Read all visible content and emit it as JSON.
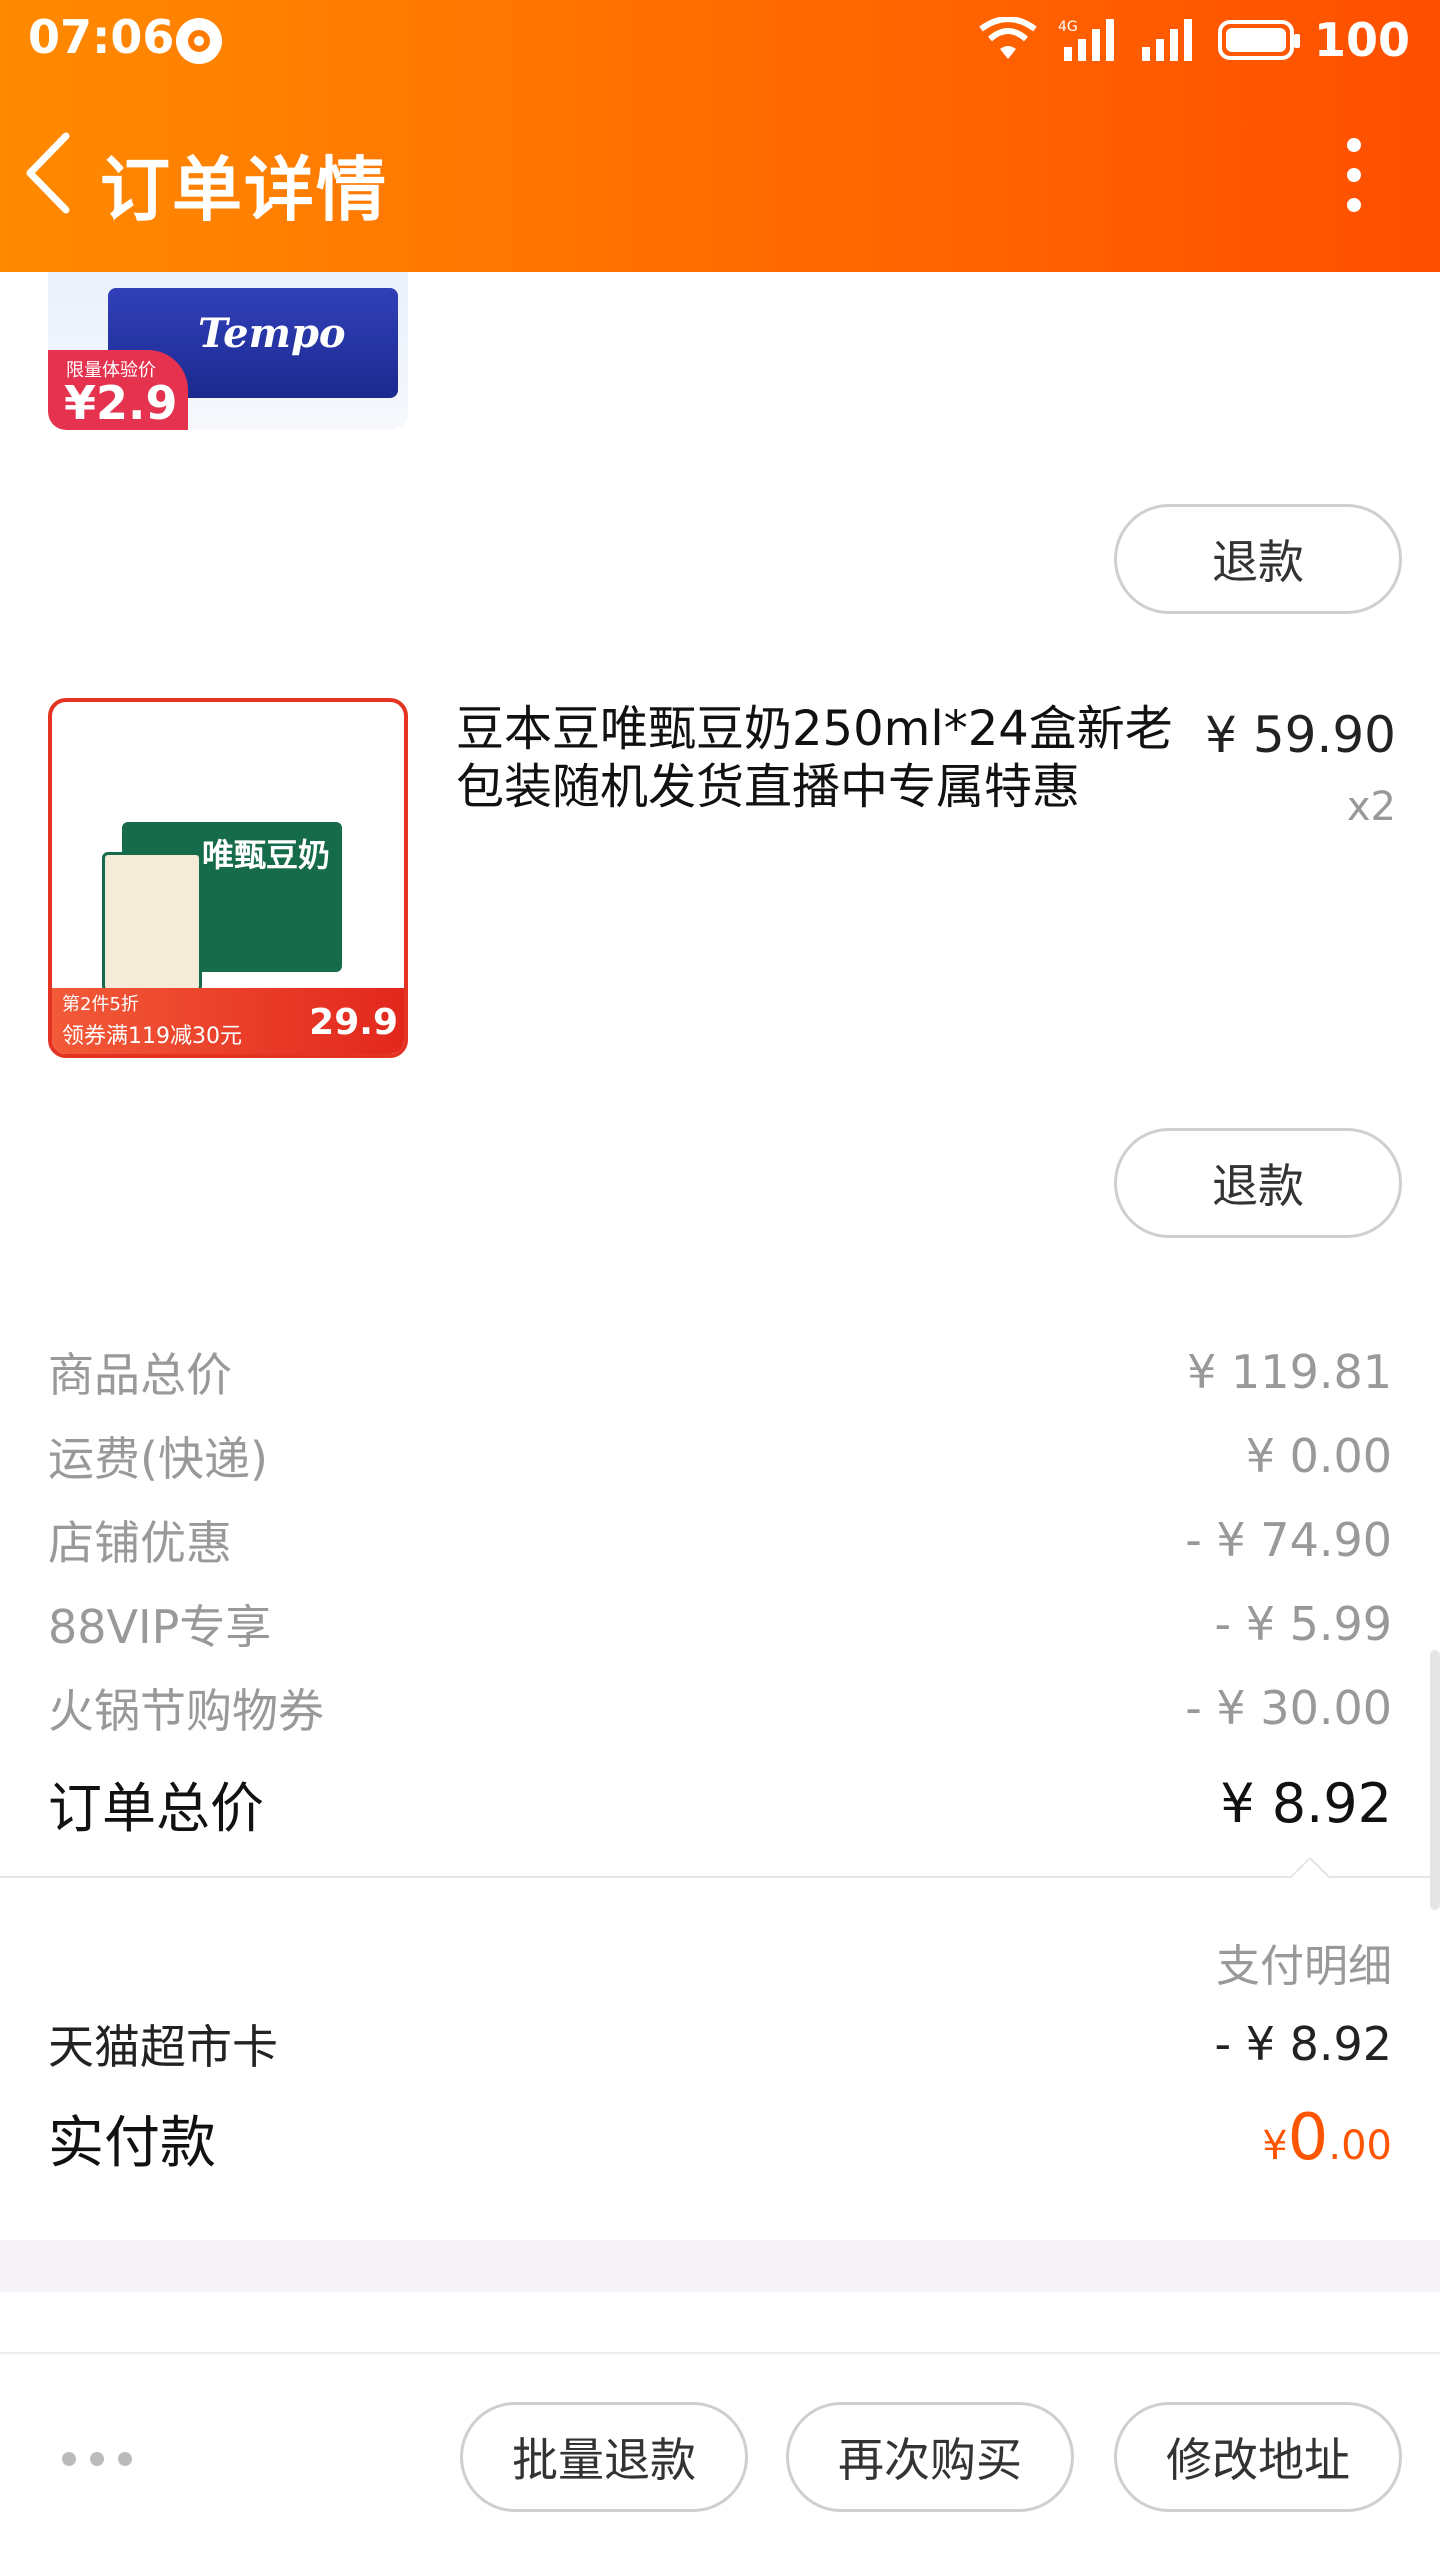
{
  "status_bar": {
    "time": "07:06",
    "battery": "100"
  },
  "nav": {
    "title": "订单详情"
  },
  "colors": {
    "accent": "#ff6a00",
    "price_highlight": "#ff5500"
  },
  "items": [
    {
      "thumbnail": {
        "badge_small": "限量体验价",
        "badge_price": "¥2.9",
        "brand": "Tempo"
      },
      "refund_label": "退款"
    },
    {
      "title": "豆本豆唯甄豆奶250ml*24盒新老包装随机发货直播中专属特惠",
      "price": "¥ 59.90",
      "quantity": "x2",
      "thumbnail": {
        "brand": "唯甄豆奶",
        "promo_1": "第2件5折",
        "promo_2": "领券满119减30元",
        "final_price": "29.9"
      },
      "refund_label": "退款"
    }
  ],
  "summary": [
    {
      "label": "商品总价",
      "value": "¥ 119.81"
    },
    {
      "label": "运费(快递)",
      "value": "¥ 0.00"
    },
    {
      "label": "店铺优惠",
      "value": "- ¥ 74.90"
    },
    {
      "label": "88VIP专享",
      "value": "- ¥ 5.99"
    },
    {
      "label": "火锅节购物券",
      "value": "- ¥ 30.00"
    }
  ],
  "order_total": {
    "label": "订单总价",
    "value": "¥ 8.92"
  },
  "payment": {
    "detail_label": "支付明细",
    "card_label": "天猫超市卡",
    "card_value": "- ¥ 8.92",
    "paid_label": "实付款",
    "paid_currency": "¥",
    "paid_int": "0",
    "paid_dec": ".00"
  },
  "bottom_actions": {
    "batch_refund": "批量退款",
    "buy_again": "再次购买",
    "change_address": "修改地址"
  }
}
